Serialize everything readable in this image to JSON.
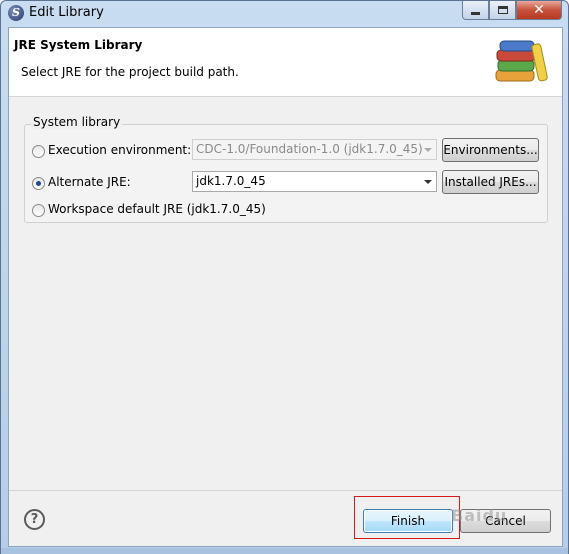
{
  "window": {
    "title": "Edit Library",
    "app_icon": "eclipse-icon"
  },
  "header": {
    "title": "JRE System Library",
    "description": "Select JRE for the project build path.",
    "icon": "library-books-icon"
  },
  "group": {
    "label": "System library",
    "options": [
      {
        "label": "Execution environment:",
        "checked": false,
        "combo_value": "CDC-1.0/Foundation-1.0 (jdk1.7.0_45)",
        "combo_enabled": false,
        "button": "Environments..."
      },
      {
        "label": "Alternate JRE:",
        "checked": true,
        "combo_value": "jdk1.7.0_45",
        "combo_enabled": true,
        "button": "Installed JREs..."
      },
      {
        "label": "Workspace default JRE (jdk1.7.0_45)",
        "checked": false
      }
    ]
  },
  "footer": {
    "help": "?",
    "finish": "Finish",
    "cancel": "Cancel",
    "watermark": "Baidu"
  },
  "colors": {
    "highlight": "#d61a1a",
    "accent": "#3c7fb1"
  }
}
